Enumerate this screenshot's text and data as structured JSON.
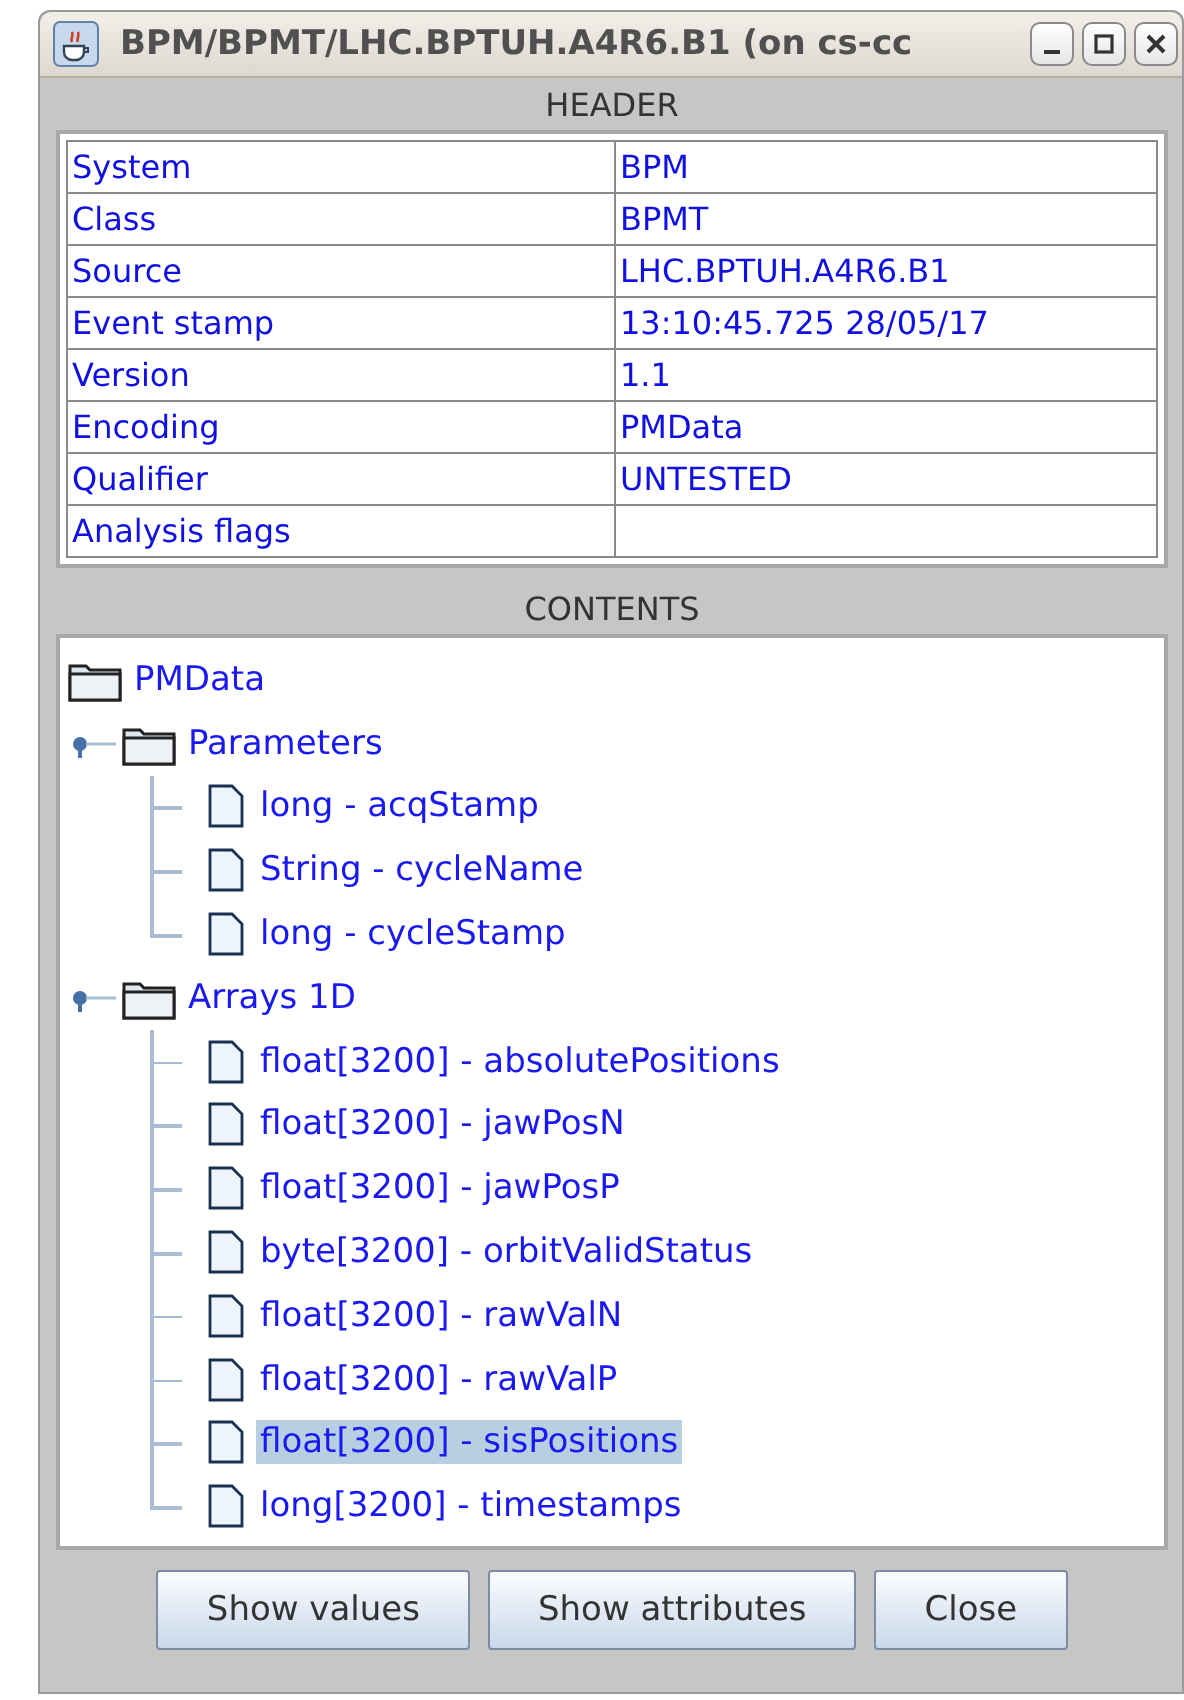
{
  "window": {
    "title": "BPM/BPMT/LHC.BPTUH.A4R6.B1 (on cs-cc"
  },
  "header": {
    "title": "HEADER",
    "rows": [
      {
        "key": "System",
        "value": "BPM"
      },
      {
        "key": "Class",
        "value": "BPMT"
      },
      {
        "key": "Source",
        "value": "LHC.BPTUH.A4R6.B1"
      },
      {
        "key": "Event stamp",
        "value": "13:10:45.725 28/05/17"
      },
      {
        "key": "Version",
        "value": "1.1"
      },
      {
        "key": "Encoding",
        "value": "PMData"
      },
      {
        "key": "Qualifier",
        "value": "UNTESTED"
      },
      {
        "key": "Analysis flags"
      }
    ]
  },
  "contents": {
    "title": "CONTENTS",
    "tree": {
      "label": "PMData",
      "selected": false,
      "children": [
        {
          "label": "Parameters",
          "expanded": true,
          "selected": false,
          "children": [
            {
              "label": "long - acqStamp",
              "kind": "file",
              "selected": false
            },
            {
              "label": "String - cycleName",
              "kind": "file",
              "selected": false
            },
            {
              "label": "long - cycleStamp",
              "kind": "file",
              "selected": false
            }
          ]
        },
        {
          "label": "Arrays 1D",
          "expanded": true,
          "selected": false,
          "children": [
            {
              "label": "float[3200] - absolutePositions",
              "kind": "file",
              "selected": false
            },
            {
              "label": "float[3200] - jawPosN",
              "kind": "file",
              "selected": false
            },
            {
              "label": "float[3200] - jawPosP",
              "kind": "file",
              "selected": false
            },
            {
              "label": "byte[3200] - orbitValidStatus",
              "kind": "file",
              "selected": false
            },
            {
              "label": "float[3200] - rawValN",
              "kind": "file",
              "selected": false
            },
            {
              "label": "float[3200] - rawValP",
              "kind": "file",
              "selected": false
            },
            {
              "label": "float[3200] - sisPositions",
              "kind": "file",
              "selected": true
            },
            {
              "label": "long[3200] - timestamps",
              "kind": "file",
              "selected": false
            }
          ]
        }
      ]
    }
  },
  "buttons": [
    "Show values",
    "Show attributes",
    "Close"
  ]
}
